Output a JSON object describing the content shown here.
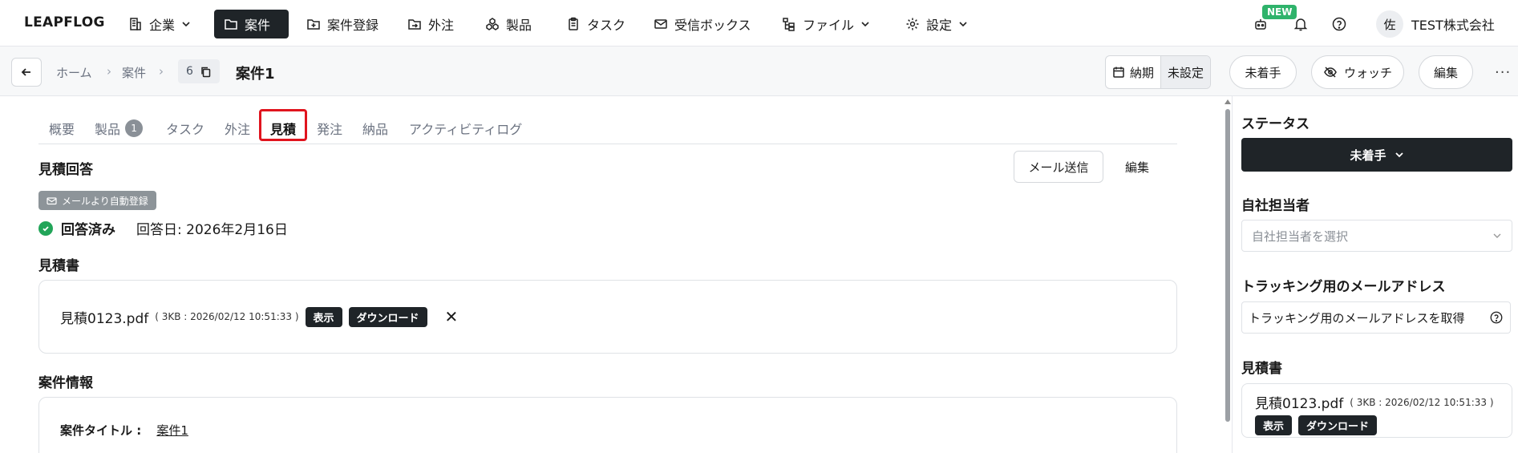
{
  "nav": {
    "brand": "LEAPFLOG",
    "items": [
      {
        "label": "企業",
        "icon": "building-icon",
        "dropdown": true
      },
      {
        "label": "案件",
        "icon": "folder-icon",
        "active": true
      },
      {
        "label": "案件登録",
        "icon": "add-box-icon"
      },
      {
        "label": "外注",
        "icon": "folder-export-icon"
      },
      {
        "label": "製品",
        "icon": "cubes-icon"
      },
      {
        "label": "タスク",
        "icon": "clipboard-icon"
      },
      {
        "label": "受信ボックス",
        "icon": "mail-icon"
      },
      {
        "label": "ファイル",
        "icon": "file-tree-icon",
        "dropdown": true
      },
      {
        "label": "設定",
        "icon": "gear-icon",
        "dropdown": true
      }
    ],
    "new_badge": "NEW",
    "avatar_initial": "佐",
    "company": "TEST株式会社"
  },
  "subheader": {
    "breadcrumb": [
      "ホーム",
      "案件"
    ],
    "case_id": "6",
    "case_title": "案件1",
    "due_label": "納期",
    "due_value": "未設定",
    "status_button": "未着手",
    "watch_button": "ウォッチ",
    "edit_button": "編集",
    "more": "···"
  },
  "tabs": [
    {
      "label": "概要"
    },
    {
      "label": "製品",
      "count": "1"
    },
    {
      "label": "タスク"
    },
    {
      "label": "外注"
    },
    {
      "label": "見積",
      "selected": true
    },
    {
      "label": "発注"
    },
    {
      "label": "納品"
    },
    {
      "label": "アクティビティログ"
    }
  ],
  "quote_answer": {
    "title": "見積回答",
    "send_mail": "メール送信",
    "edit": "編集",
    "auto_tag": "メールより自動登録",
    "status": "回答済み",
    "answer_date": "回答日: 2026年2月16日"
  },
  "quote_doc": {
    "title": "見積書",
    "file_name": "見積0123.pdf",
    "file_meta": "( 3KB : 2026/02/12 10:51:33 )",
    "view": "表示",
    "download": "ダウンロード",
    "remove": "✕"
  },
  "case_info": {
    "title": "案件情報",
    "label": "案件タイトル :",
    "value": "案件1"
  },
  "right": {
    "status_title": "ステータス",
    "status_value": "未着手",
    "owner_title": "自社担当者",
    "owner_placeholder": "自社担当者を選択",
    "tracking_title": "トラッキング用のメールアドレス",
    "tracking_button": "トラッキング用のメールアドレスを取得",
    "doc_title": "見積書",
    "file_name": "見積0123.pdf",
    "file_meta": "( 3KB : 2026/02/12 10:51:33 )",
    "view": "表示",
    "download": "ダウンロード"
  },
  "colors": {
    "accent_dark": "#1f2428",
    "highlight": "#e0141e",
    "success": "#22a559",
    "new_badge": "#2fb36b"
  }
}
